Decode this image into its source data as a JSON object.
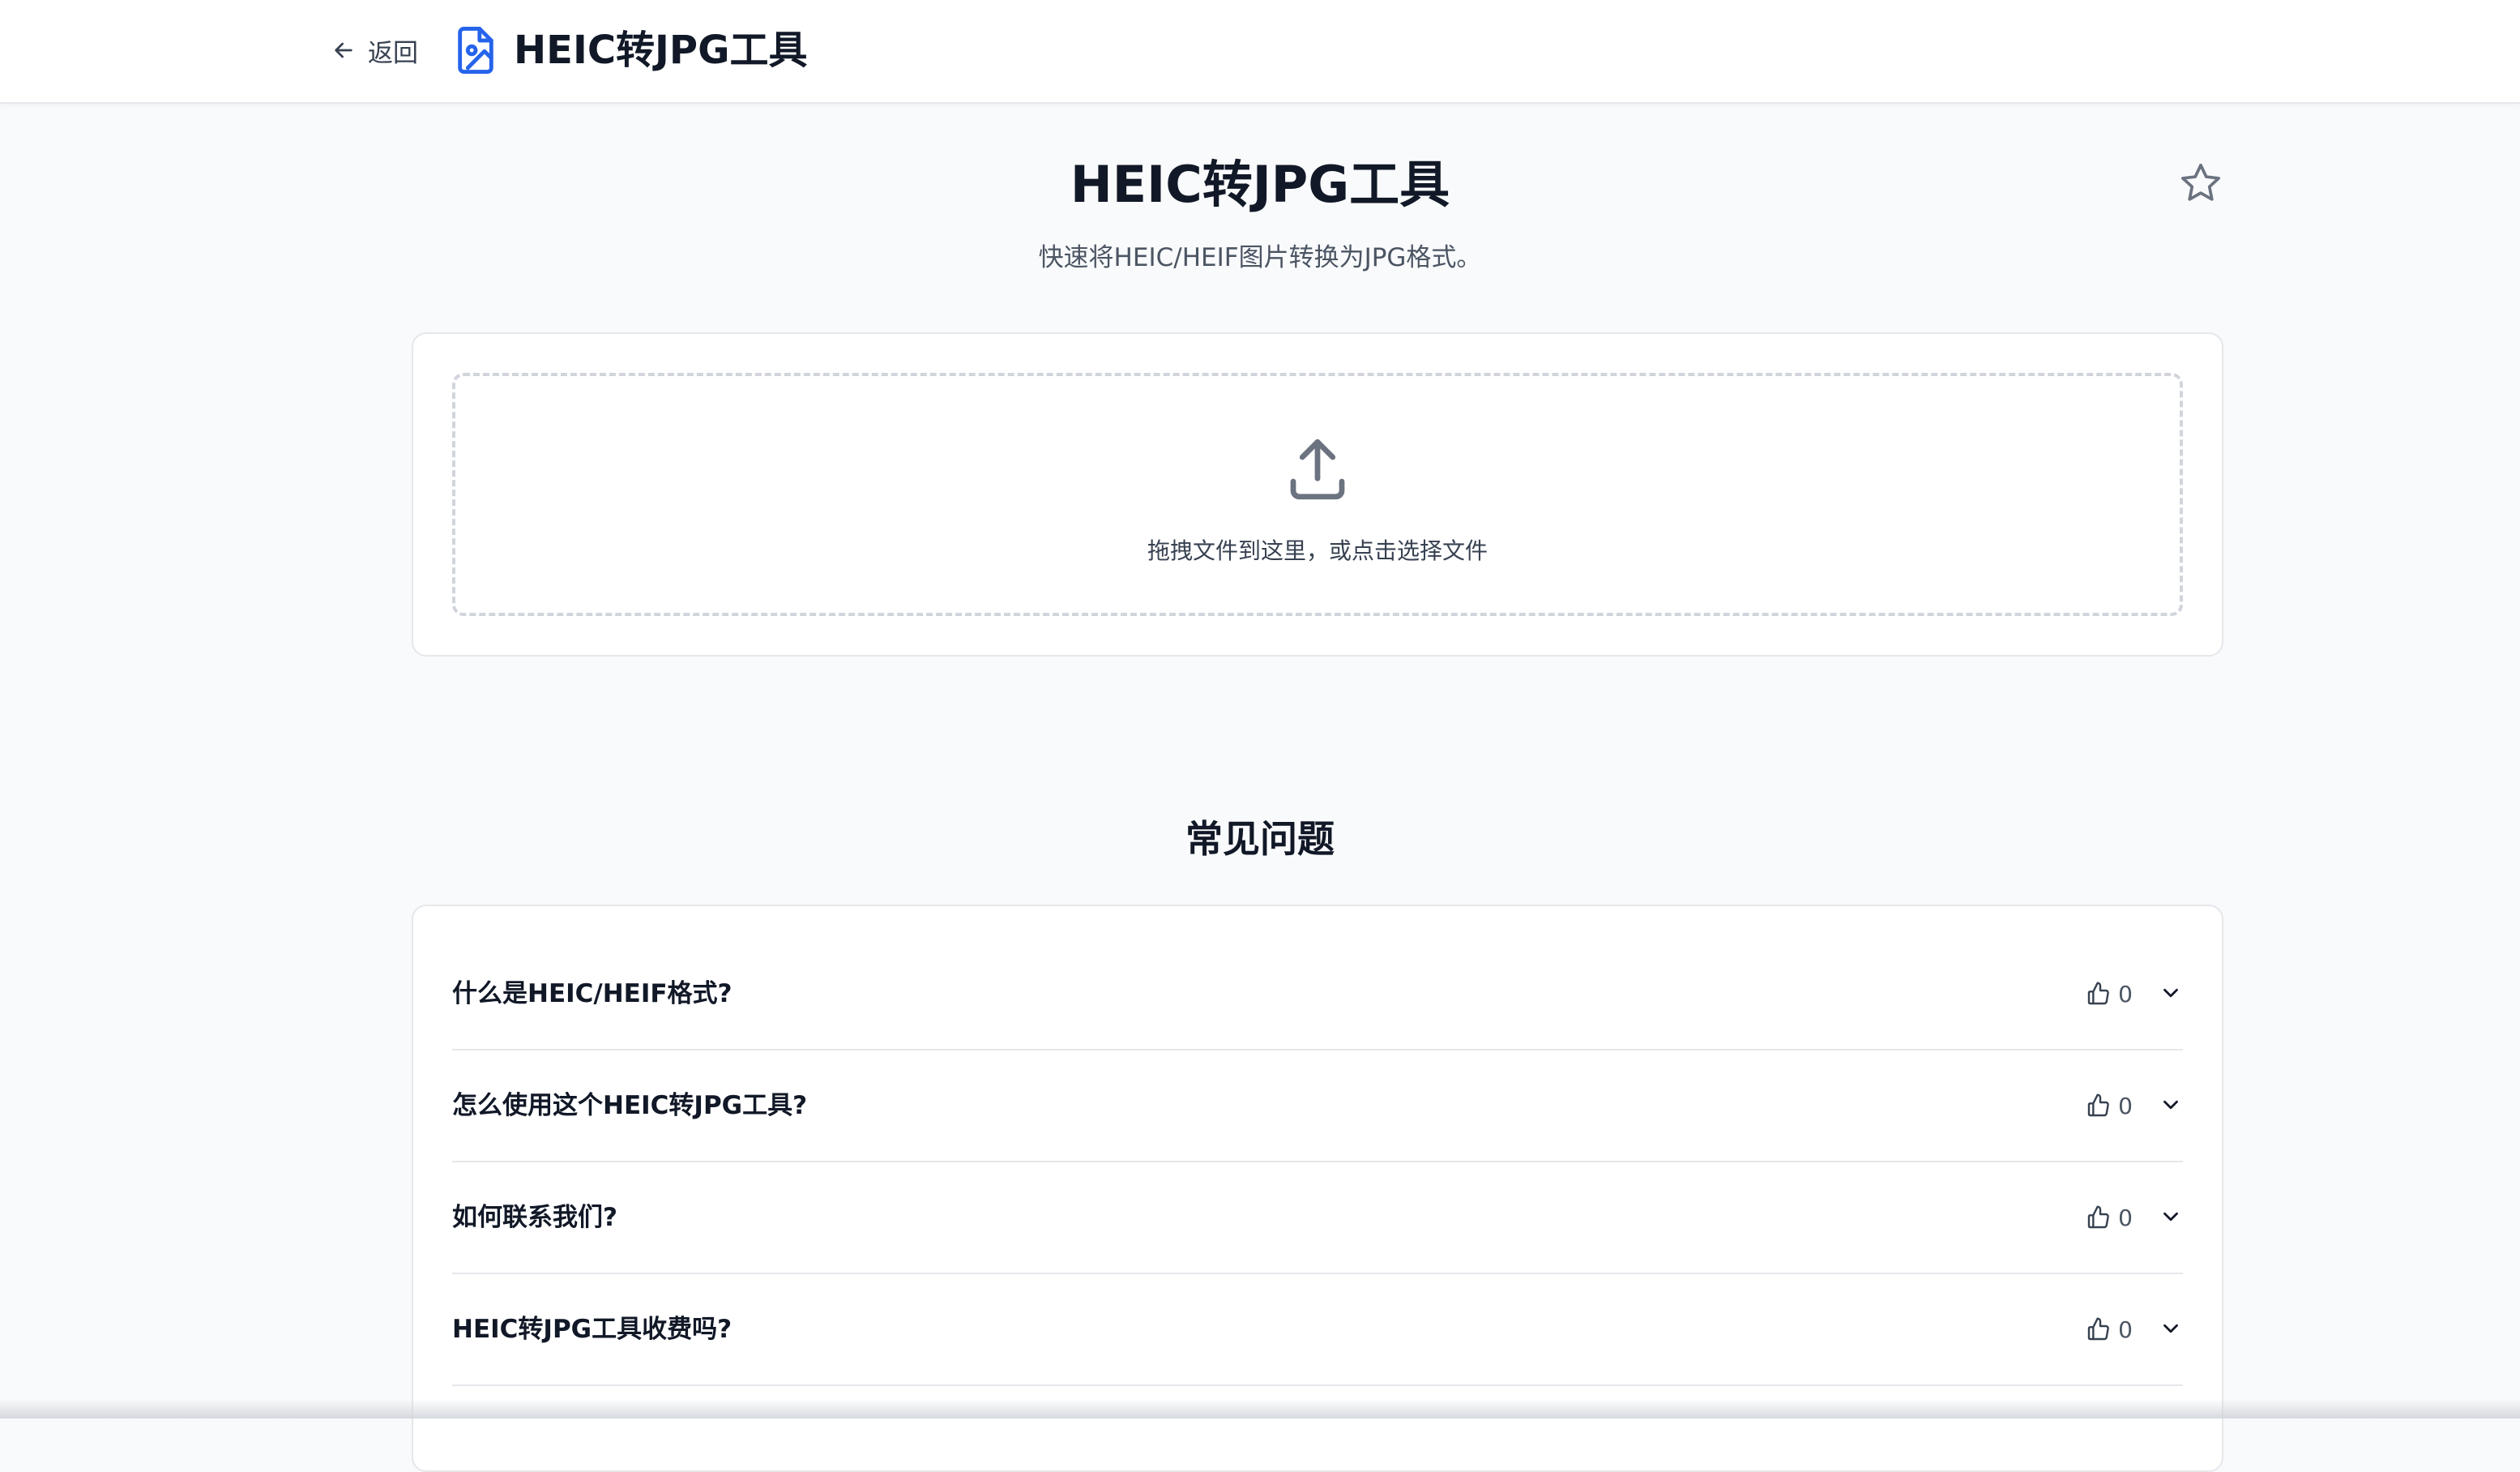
{
  "header": {
    "back_label": "返回",
    "app_icon": "file-image-icon",
    "app_title": "HEIC转JPG工具"
  },
  "hero": {
    "title": "HEIC转JPG工具",
    "subtitle": "快速将HEIC/HEIF图片转换为JPG格式。",
    "favorite_icon": "star-icon"
  },
  "upload": {
    "icon": "upload-icon",
    "hint": "拖拽文件到这里，或点击选择文件"
  },
  "faq": {
    "heading": "常见问题",
    "items": [
      {
        "question": "什么是HEIC/HEIF格式?",
        "likes": "0"
      },
      {
        "question": "怎么使用这个HEIC转JPG工具?",
        "likes": "0"
      },
      {
        "question": "如何联系我们?",
        "likes": "0"
      },
      {
        "question": "HEIC转JPG工具收费吗?",
        "likes": "0"
      }
    ]
  },
  "colors": {
    "accent": "#2563eb",
    "background": "#f9fafb",
    "card": "#ffffff",
    "border": "#e5e7eb",
    "text": "#111827",
    "muted": "#4b5563"
  }
}
